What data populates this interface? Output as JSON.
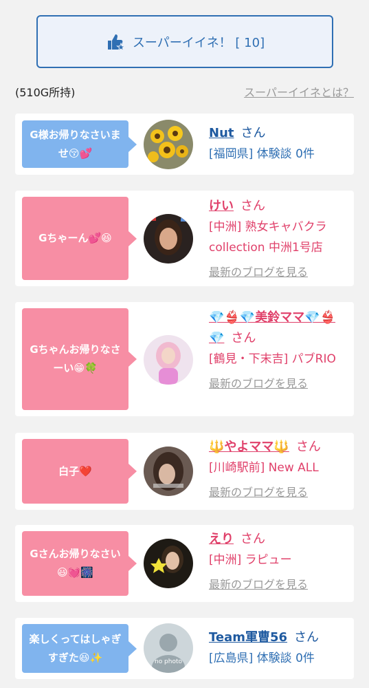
{
  "super_button": {
    "label": "スーパーイイネ！ [ 10]"
  },
  "gold": {
    "text": "(510G所持)"
  },
  "about_link": {
    "text": "スーパーイイネとは？"
  },
  "cards": [
    {
      "bubble": "G様お帰りなさいませ😚💕",
      "name": "Nut",
      "honorific": "さん",
      "sub": "[福岡県] 体験談 0件",
      "blog": ""
    },
    {
      "bubble": "Gちゃーん💕😆",
      "name": "けい",
      "honorific": "さん",
      "sub": "[中洲] 熟女キャバクラcollection 中洲1号店",
      "blog": "最新のブログを見る"
    },
    {
      "bubble": "Gちゃんお帰りなさーい😁🍀",
      "name": "💎👙💎美鈴ママ💎👙💎",
      "honorific": "さん",
      "sub": "[鶴見・下末吉] パブRIO",
      "blog": "最新のブログを見る"
    },
    {
      "bubble": "白子❤️",
      "name": "🔱やよママ🔱",
      "honorific": "さん",
      "sub": "[川崎駅前] New ALL",
      "blog": "最新のブログを見る"
    },
    {
      "bubble": "Gさんお帰りなさい😃💓🎆",
      "name": "えり",
      "honorific": "さん",
      "sub": "[中洲] ラピュー",
      "blog": "最新のブログを見る"
    },
    {
      "bubble": "楽しくってはしゃぎすぎた😆✨",
      "name": "Team軍曹56",
      "honorific": "さん",
      "sub": "[広島県] 体験談 0件",
      "blog": ""
    }
  ],
  "no_photo_text": "no photo",
  "colors": {
    "blue": "#2f6fb3",
    "pink": "#e0406a",
    "bubble_blue": "#80b4ee",
    "bubble_pink": "#f78ea4"
  }
}
